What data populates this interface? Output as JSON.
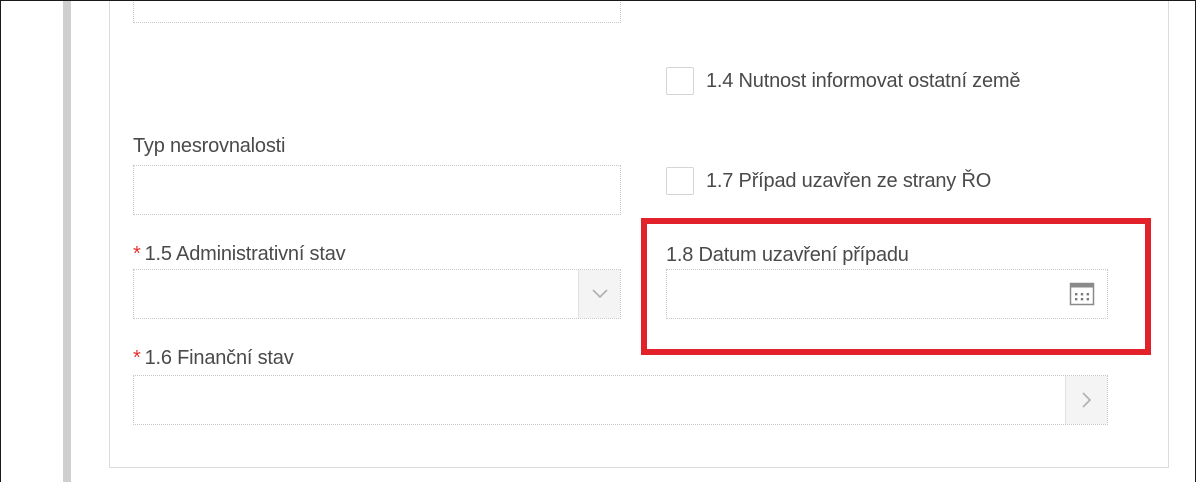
{
  "form": {
    "typ_label": "Typ nesrovnalosti",
    "admin_required_mark": "*",
    "admin_label": "1.5 Administrativní stav",
    "admin_value": "",
    "financni_required_mark": "*",
    "financni_label": "1.6 Finanční stav",
    "financni_value": "",
    "checkbox_14_label": "1.4 Nutnost informovat ostatní země",
    "checkbox_14_checked": false,
    "checkbox_17_label": "1.7 Případ uzavřen ze strany ŘO",
    "checkbox_17_checked": false,
    "date_label": "1.8 Datum uzavření případu",
    "date_value": ""
  },
  "icons": {
    "admin_dropdown": "chevron-down-icon",
    "financni_next": "chevron-right-icon",
    "date_picker": "calendar-icon"
  },
  "colors": {
    "required": "#e0312f",
    "highlight": "#e3212b"
  }
}
